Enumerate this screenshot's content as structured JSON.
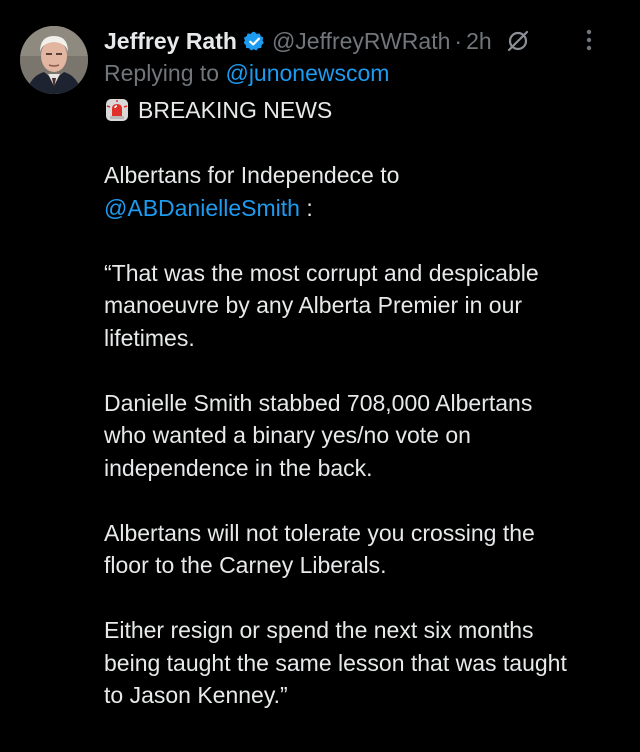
{
  "author": {
    "name": "Jeffrey Rath",
    "handle": "@JeffreyRWRath",
    "separator": "·",
    "time": "2h",
    "verified_color": "#1d9bf0"
  },
  "reply": {
    "prefix": "Replying to ",
    "mention": "@junonewscom"
  },
  "icons": {
    "verified": "verified-badge-icon",
    "grok": "grok-icon",
    "more": "more-options-icon",
    "siren": "siren-emoji-icon"
  },
  "body": {
    "breaking": "BREAKING NEWS",
    "p1_line1": "Albertans for Independece to",
    "p1_mention": "@ABDanielleSmith",
    "p1_colon": " :",
    "p2_line1": "“That was the most corrupt and despicable",
    "p2_line2": "manoeuvre by any Alberta Premier in our",
    "p2_line3": "lifetimes.",
    "p3_line1": "Danielle Smith stabbed 708,000 Albertans",
    "p3_line2": "who wanted a binary yes/no vote on",
    "p3_line3": "independence in the back.",
    "p4_line1": "Albertans will not tolerate you crossing the",
    "p4_line2": "floor to the Carney Liberals.",
    "p5_line1": "Either resign or spend the next six months",
    "p5_line2": "being taught the same lesson that was taught",
    "p5_line3": "to Jason Kenney.”"
  },
  "colors": {
    "background": "#000000",
    "text": "#e7e9ea",
    "secondary": "#71767b",
    "link": "#1d9bf0"
  }
}
